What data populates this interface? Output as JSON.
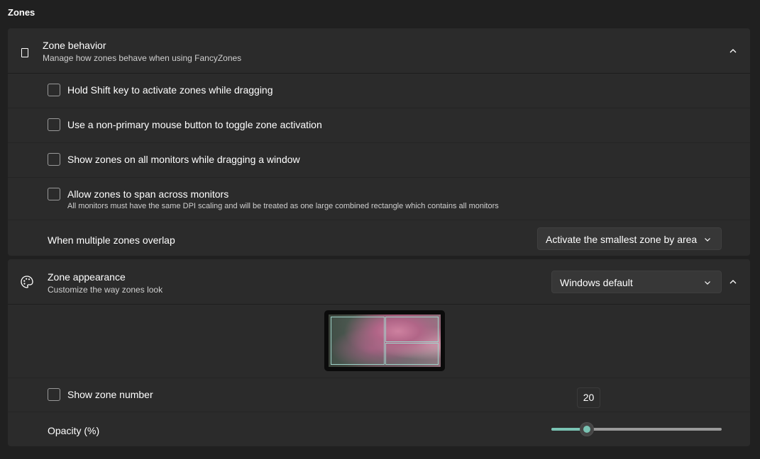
{
  "page": {
    "section_title": "Zones"
  },
  "zone_behavior": {
    "title": "Zone behavior",
    "subtitle": "Manage how zones behave when using FancyZones",
    "icon": "zones-rectangle-icon",
    "options": [
      {
        "label": "Hold Shift key to activate zones while dragging",
        "checked": false
      },
      {
        "label": "Use a non-primary mouse button to toggle zone activation",
        "checked": false
      },
      {
        "label": "Show zones on all monitors while dragging a window",
        "checked": false
      },
      {
        "label": "Allow zones to span across monitors",
        "description": "All monitors must have the same DPI scaling and will be treated as one large combined rectangle which contains all monitors",
        "checked": false
      }
    ],
    "overlap": {
      "label": "When multiple zones overlap",
      "selected": "Activate the smallest zone by area"
    }
  },
  "zone_appearance": {
    "title": "Zone appearance",
    "subtitle": "Customize the way zones look",
    "icon": "palette-icon",
    "theme_selected": "Windows default",
    "show_zone_number": {
      "label": "Show zone number",
      "checked": false
    },
    "opacity": {
      "label": "Opacity (%)",
      "value": 20,
      "tooltip": "20",
      "min": 0,
      "max": 100
    }
  },
  "colors": {
    "accent": "#7ac3b3",
    "background": "#202020",
    "card": "#2b2b2b"
  }
}
